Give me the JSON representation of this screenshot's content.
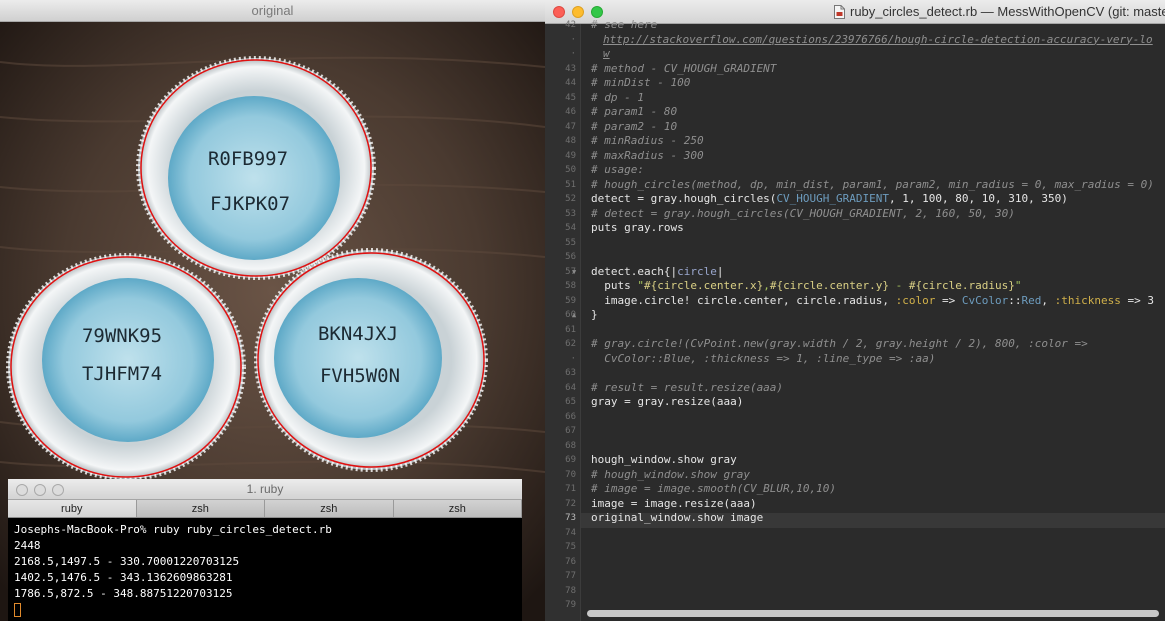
{
  "image_window": {
    "title": "original",
    "caps": [
      {
        "line1": "R0FB997",
        "line2": "FJKPK07"
      },
      {
        "line1": "79WNK95",
        "line2": "TJHFM74"
      },
      {
        "line1": "BKN4JXJ",
        "line2": "FVH5W0N"
      }
    ]
  },
  "terminal": {
    "title": "1. ruby",
    "tabs": [
      "ruby",
      "zsh",
      "zsh",
      "zsh"
    ],
    "lines": [
      "Josephs-MacBook-Pro% ruby ruby_circles_detect.rb",
      "2448",
      "2168.5,1497.5 - 330.70001220703125",
      "1402.5,1476.5 - 343.1362609863281",
      "1786.5,872.5 - 348.88751220703125"
    ]
  },
  "editor": {
    "title": "ruby_circles_detect.rb — MessWithOpenCV (git: master",
    "colors": {
      "background": "#2b2b2b",
      "comment": "#8f8f8f",
      "constant": "#6d9cbe",
      "symbol": "#d0b04a",
      "string": "#a5c25c"
    },
    "line_numbers": [
      "42",
      "·",
      "·",
      "43",
      "44",
      "45",
      "46",
      "47",
      "48",
      "49",
      "50",
      "51",
      "52",
      "53",
      "54",
      "55",
      "56",
      "57",
      "58",
      "59",
      "60",
      "61",
      "62",
      "·",
      "63",
      "64",
      "65",
      "66",
      "67",
      "68",
      "69",
      "70",
      "71",
      "72",
      "73",
      "74",
      "75",
      "76",
      "77",
      "78",
      "79"
    ],
    "current_line": "73",
    "code": {
      "l42": "# see here",
      "l42b": "http://stackoverflow.com/questions/23976766/hough-circle-detection-accuracy-very-lo",
      "l42c": "w",
      "l43": "# method - CV_HOUGH_GRADIENT",
      "l44": "# minDist - 100",
      "l45": "# dp - 1",
      "l46": "# param1 - 80",
      "l47": "# param2 - 10",
      "l48": "# minRadius - 250",
      "l49": "# maxRadius - 300",
      "l50": "# usage:",
      "l51": "# hough_circles(method, dp, min_dist, param1, param2, min_radius = 0, max_radius = 0)",
      "l52a": "detect = gray.hough_circles(",
      "l52b": "CV_HOUGH_GRADIENT",
      "l52c": ", 1, 100, 80, 10, 310, 350)",
      "l53": "# detect = gray.hough_circles(CV_HOUGH_GRADIENT, 2, 160, 50, 30)",
      "l54": "puts gray.rows",
      "l57a": "detect.each{|",
      "l57b": "circle",
      "l57c": "|",
      "l58a": "  puts ",
      "l58b": "\"",
      "l58c": "#{circle.center.x}",
      "l58d": ",",
      "l58e": "#{circle.center.y}",
      "l58f": " - ",
      "l58g": "#{circle.radius}",
      "l58h": "\"",
      "l59a": "  image.circle! circle.center, circle.radius, ",
      "l59b": ":color",
      "l59c": " => ",
      "l59d": "CvColor",
      "l59e": "::",
      "l59f": "Red",
      "l59g": ", ",
      "l59h": ":thickness",
      "l59i": " => 3",
      "l60": "}",
      "l62a": "# gray.circle!(CvPoint.new(gray.width / 2, gray.height / 2), 800, :color =>",
      "l62b": "  CvColor::Blue, :thickness => 1, :line_type => :aa)",
      "l64": "# result = result.resize(aaa)",
      "l65": "gray = gray.resize(aaa)",
      "l69": "hough_window.show gray",
      "l70": "# hough_window.show gray",
      "l71": "# image = image.smooth(CV_BLUR,10,10)",
      "l72": "image = image.resize(aaa)",
      "l73": "original_window.show image"
    }
  }
}
